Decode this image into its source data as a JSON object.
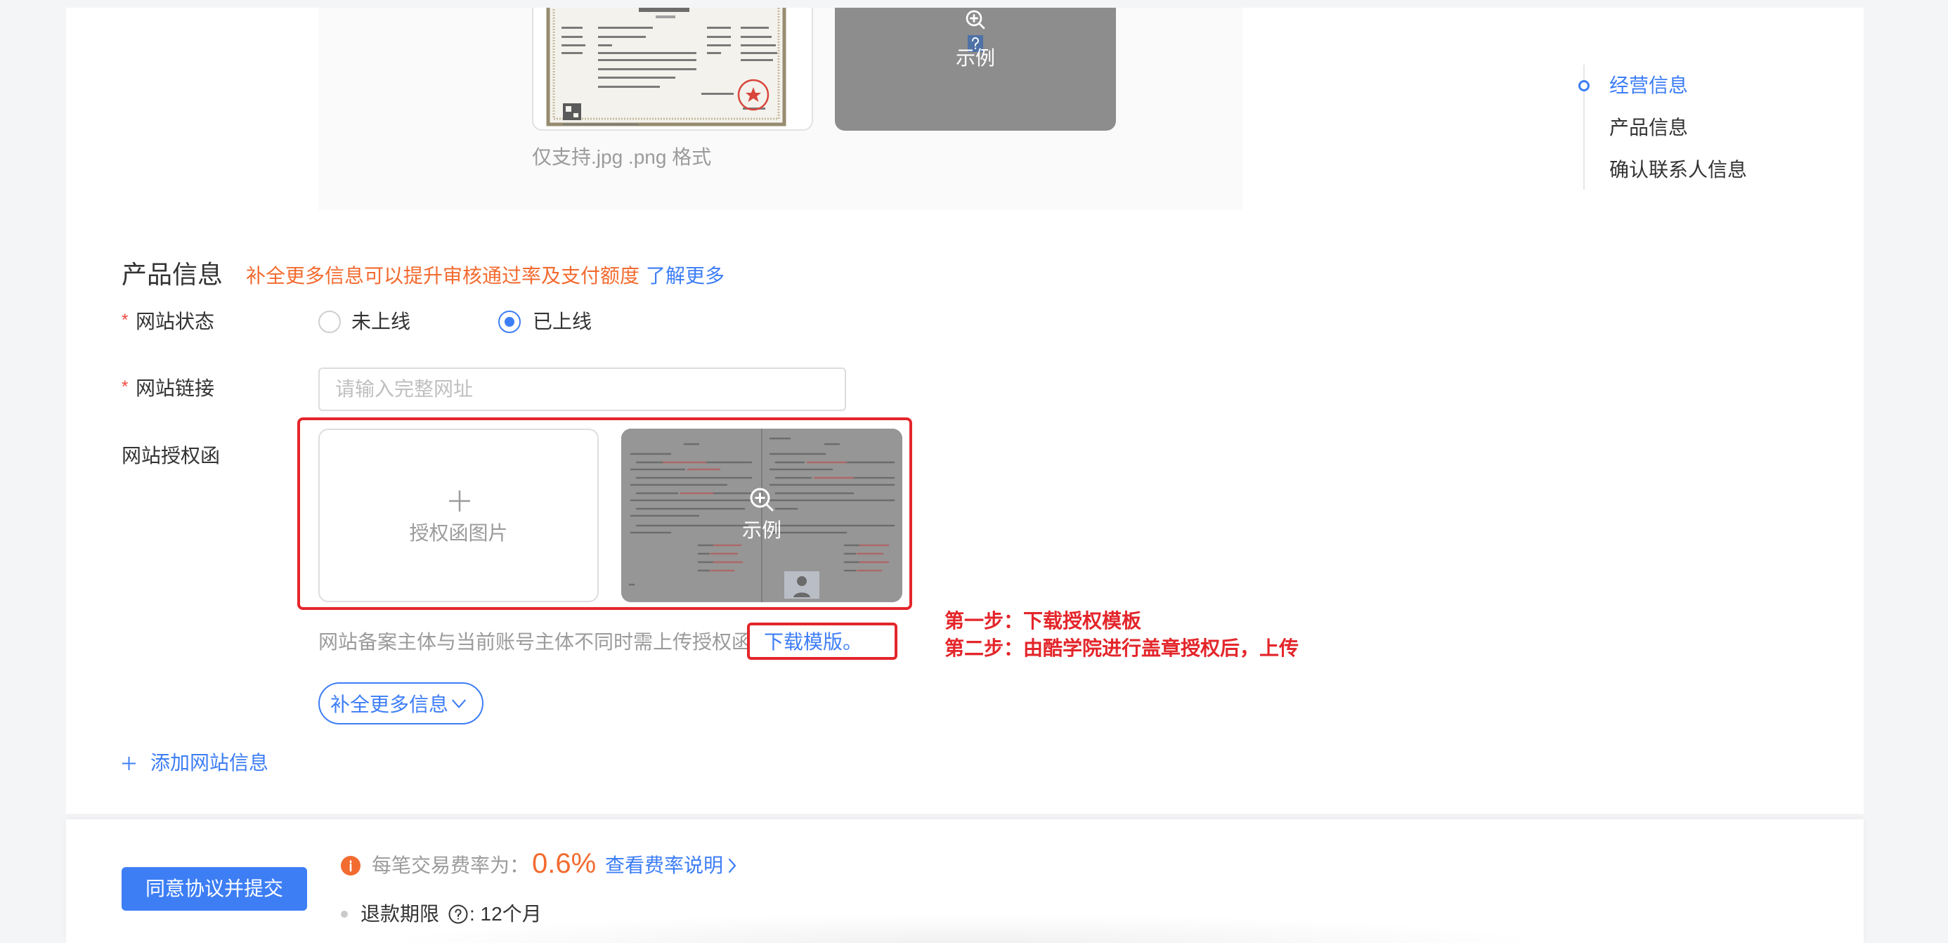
{
  "colors": {
    "primary": "#3d7ef5",
    "accent_orange": "#f26b30",
    "annotation_red": "#e3262b",
    "required_red": "#f0483e"
  },
  "icons": [
    "zoom-in-icon",
    "question-image-icon",
    "plus-icon",
    "chevron-down-icon",
    "chevron-right-icon",
    "info-icon",
    "question-circle-icon"
  ],
  "top_upload": {
    "example_label": "示例",
    "format_hint": "仅支持.jpg .png 格式"
  },
  "side_nav": {
    "items": [
      {
        "label": "经营信息",
        "active": true
      },
      {
        "label": "产品信息",
        "active": false
      },
      {
        "label": "确认联系人信息",
        "active": false
      }
    ]
  },
  "product": {
    "title": "产品信息",
    "hint": "补全更多信息可以提升审核通过率及支付额度",
    "learn_more": "了解更多",
    "status": {
      "required_mark": "*",
      "label": "网站状态",
      "options": [
        {
          "label": "未上线",
          "checked": false
        },
        {
          "label": "已上线",
          "checked": true
        }
      ]
    },
    "link": {
      "required_mark": "*",
      "label": "网站链接",
      "value": "",
      "placeholder": "请输入完整网址"
    },
    "auth_letter": {
      "label": "网站授权函",
      "upload_label": "授权函图片",
      "example_label": "示例",
      "hint": "网站备案主体与当前账号主体不同时需上传授权函",
      "download_link": "下载模版。"
    },
    "more_info_button": "补全更多信息",
    "add_site": "添加网站信息"
  },
  "annotations": {
    "step1": "第一步：下载授权模板",
    "step2": "第二步：由酷学院进行盖章授权后，上传"
  },
  "footer": {
    "submit_button": "同意协议并提交",
    "fee_label": "每笔交易费率为：",
    "fee_value": "0.6%",
    "fee_link": "查看费率说明",
    "refund_label": "退款期限",
    "refund_value": ": 12个月"
  }
}
